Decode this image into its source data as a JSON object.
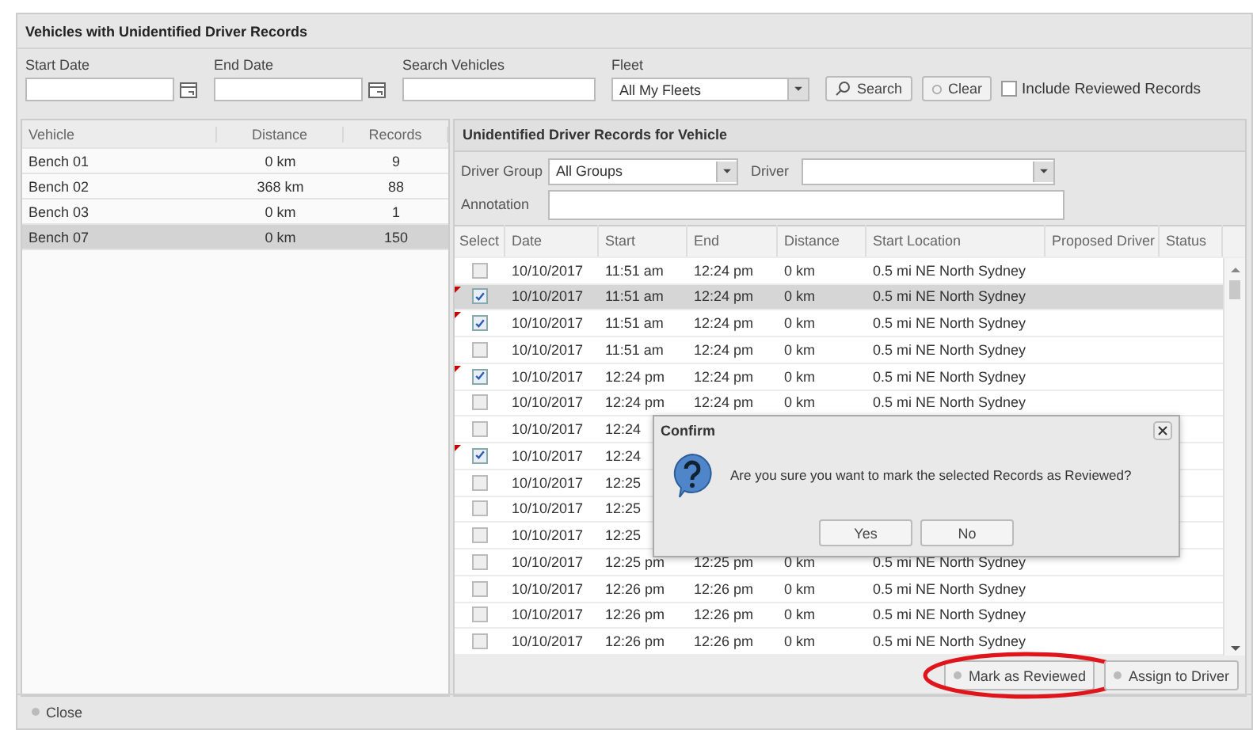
{
  "window": {
    "title": "Vehicles with Unidentified Driver Records"
  },
  "filters": [
    {
      "label": "Start Date",
      "kind": "date"
    },
    {
      "label": "End Date",
      "kind": "date"
    },
    {
      "label": "Search Vehicles",
      "kind": "text"
    },
    {
      "label": "Fleet",
      "kind": "select",
      "value": "All My Fleets"
    }
  ],
  "search_button": "Search",
  "clear_button": "Clear",
  "include_reviewed": {
    "label": "Include Reviewed Records",
    "checked": false
  },
  "vehicles": {
    "columns": [
      "Vehicle",
      "Distance",
      "Records"
    ],
    "rows": [
      {
        "vehicle": "Bench 01",
        "distance": "0 km",
        "records": "9",
        "selected": false
      },
      {
        "vehicle": "Bench 02",
        "distance": "368 km",
        "records": "88",
        "selected": false
      },
      {
        "vehicle": "Bench 03",
        "distance": "0 km",
        "records": "1",
        "selected": false
      },
      {
        "vehicle": "Bench 07",
        "distance": "0 km",
        "records": "150",
        "selected": true
      }
    ]
  },
  "records_panel": {
    "title": "Unidentified Driver Records for Vehicle",
    "driver_group": {
      "label": "Driver Group",
      "value": "All Groups"
    },
    "driver": {
      "label": "Driver"
    },
    "annotation": {
      "label": "Annotation"
    },
    "columns": [
      "Select",
      "Date",
      "Start",
      "End",
      "Distance",
      "Start Location",
      "Proposed Driver",
      "Status"
    ],
    "rows": [
      {
        "checked": false,
        "selected": false,
        "date": "10/10/2017",
        "start": "11:51 am",
        "end": "12:24 pm",
        "distance": "0 km",
        "location": "0.5 mi NE North Sydney"
      },
      {
        "checked": true,
        "selected": true,
        "date": "10/10/2017",
        "start": "11:51 am",
        "end": "12:24 pm",
        "distance": "0 km",
        "location": "0.5 mi NE North Sydney"
      },
      {
        "checked": true,
        "selected": false,
        "date": "10/10/2017",
        "start": "11:51 am",
        "end": "12:24 pm",
        "distance": "0 km",
        "location": "0.5 mi NE North Sydney"
      },
      {
        "checked": false,
        "selected": false,
        "date": "10/10/2017",
        "start": "11:51 am",
        "end": "12:24 pm",
        "distance": "0 km",
        "location": "0.5 mi NE North Sydney"
      },
      {
        "checked": true,
        "selected": false,
        "date": "10/10/2017",
        "start": "12:24 pm",
        "end": "12:24 pm",
        "distance": "0 km",
        "location": "0.5 mi NE North Sydney"
      },
      {
        "checked": false,
        "selected": false,
        "date": "10/10/2017",
        "start": "12:24 pm",
        "end": "12:24 pm",
        "distance": "0 km",
        "location": "0.5 mi NE North Sydney"
      },
      {
        "checked": false,
        "selected": false,
        "date": "10/10/2017",
        "start": "12:24"
      },
      {
        "checked": true,
        "selected": false,
        "date": "10/10/2017",
        "start": "12:24"
      },
      {
        "checked": false,
        "selected": false,
        "date": "10/10/2017",
        "start": "12:25"
      },
      {
        "checked": false,
        "selected": false,
        "date": "10/10/2017",
        "start": "12:25"
      },
      {
        "checked": false,
        "selected": false,
        "date": "10/10/2017",
        "start": "12:25"
      },
      {
        "checked": false,
        "selected": false,
        "date": "10/10/2017",
        "start": "12:25 pm",
        "end": "12:25 pm",
        "distance": "0 km",
        "location": "0.5 mi NE North Sydney"
      },
      {
        "checked": false,
        "selected": false,
        "date": "10/10/2017",
        "start": "12:26 pm",
        "end": "12:26 pm",
        "distance": "0 km",
        "location": "0.5 mi NE North Sydney"
      },
      {
        "checked": false,
        "selected": false,
        "date": "10/10/2017",
        "start": "12:26 pm",
        "end": "12:26 pm",
        "distance": "0 km",
        "location": "0.5 mi NE North Sydney"
      },
      {
        "checked": false,
        "selected": false,
        "date": "10/10/2017",
        "start": "12:26 pm",
        "end": "12:26 pm",
        "distance": "0 km",
        "location": "0.5 mi NE North Sydney"
      }
    ]
  },
  "buttons": [
    {
      "label": "Mark as Reviewed",
      "circled": true
    },
    {
      "label": "Assign to Driver",
      "circled": false
    }
  ],
  "dialog": {
    "title": "Confirm",
    "message": "Are you sure you want to mark the selected Records as Reviewed?",
    "buttons": [
      "Yes",
      "No"
    ]
  },
  "close_button": "Close"
}
